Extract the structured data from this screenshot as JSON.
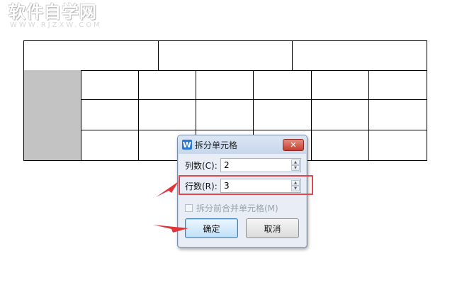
{
  "watermark": {
    "main": "软件自学网",
    "sub": "WWW.RJZXW.COM"
  },
  "dialog": {
    "title": "拆分单元格",
    "app_icon_letter": "W",
    "close_symbol": "✕",
    "columns": {
      "label": "列数(C):",
      "value": "2"
    },
    "rows": {
      "label": "行数(R):",
      "value": "3"
    },
    "merge_checkbox": {
      "label": "拆分前合并单元格(M)",
      "checked": false,
      "enabled": false
    },
    "ok_label": "确定",
    "cancel_label": "取消"
  },
  "colors": {
    "highlight": "#e0474c",
    "arrow": "#e0343a",
    "gray_cell": "#c3c3c3"
  }
}
